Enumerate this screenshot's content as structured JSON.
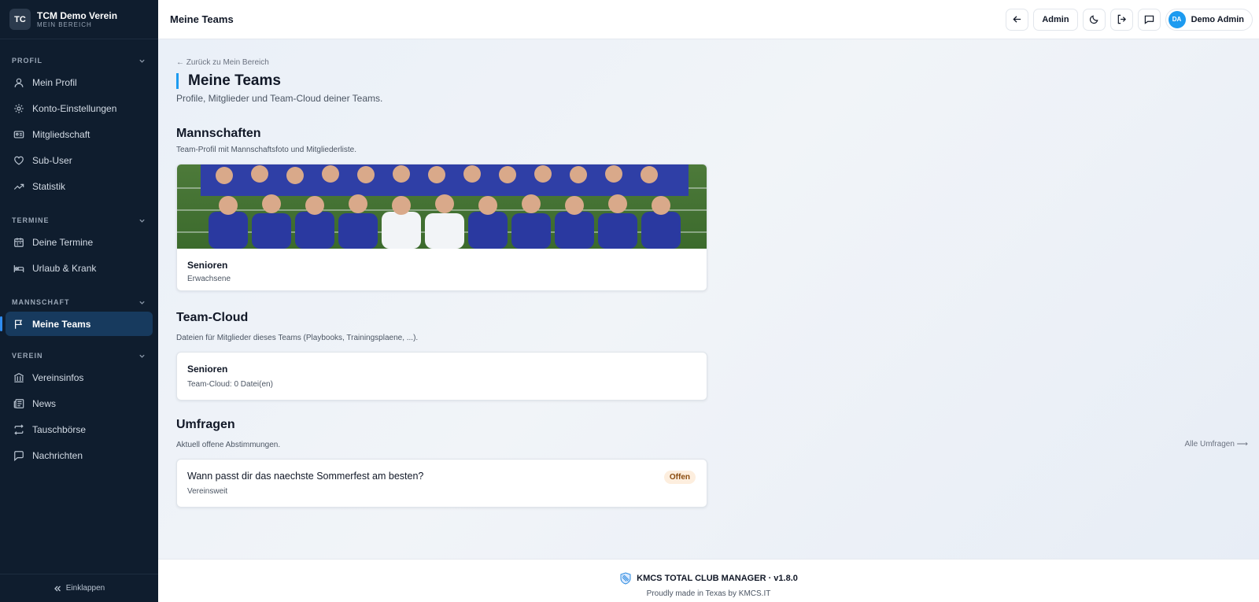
{
  "brand": {
    "badge": "TC",
    "title": "TCM Demo Verein",
    "subtitle": "MEIN BEREICH"
  },
  "sidebar": {
    "sections": [
      {
        "title": "PROFIL",
        "items": [
          {
            "label": "Mein Profil",
            "icon": "user-icon"
          },
          {
            "label": "Konto-Einstellungen",
            "icon": "gear-icon"
          },
          {
            "label": "Mitgliedschaft",
            "icon": "id-card-icon"
          },
          {
            "label": "Sub-User",
            "icon": "heart-icon"
          },
          {
            "label": "Statistik",
            "icon": "trend-icon"
          }
        ]
      },
      {
        "title": "TERMINE",
        "items": [
          {
            "label": "Deine Termine",
            "icon": "calendar-icon"
          },
          {
            "label": "Urlaub & Krank",
            "icon": "bed-icon"
          }
        ]
      },
      {
        "title": "MANNSCHAFT",
        "items": [
          {
            "label": "Meine Teams",
            "icon": "flag-icon",
            "active": true
          }
        ]
      },
      {
        "title": "VEREIN",
        "items": [
          {
            "label": "Vereinsinfos",
            "icon": "building-icon"
          },
          {
            "label": "News",
            "icon": "newspaper-icon"
          },
          {
            "label": "Tauschbörse",
            "icon": "swap-icon"
          },
          {
            "label": "Nachrichten",
            "icon": "message-icon"
          }
        ]
      }
    ],
    "collapse_label": "Einklappen"
  },
  "header": {
    "title": "Meine Teams",
    "admin_label": "Admin",
    "user": {
      "initials": "DA",
      "name": "Demo Admin"
    }
  },
  "main": {
    "back_link": "← Zurück zu Mein Bereich",
    "title": "Meine Teams",
    "subtitle": "Profile, Mitglieder und Team-Cloud deiner Teams.",
    "teams": {
      "title": "Mannschaften",
      "subtitle": "Team-Profil mit Mannschaftsfoto und Mitgliederliste.",
      "card": {
        "name": "Senioren",
        "category": "Erwachsene"
      }
    },
    "cloud": {
      "title": "Team-Cloud",
      "subtitle": "Dateien für Mitglieder dieses Teams (Playbooks, Trainingsplaene, ...).",
      "card": {
        "name": "Senioren",
        "info": "Team-Cloud: 0 Datei(en)"
      }
    },
    "polls": {
      "title": "Umfragen",
      "subtitle": "Aktuell offene Abstimmungen.",
      "all_link": "Alle Umfragen ⟶",
      "card": {
        "question": "Wann passt dir das naechste Sommerfest am besten?",
        "scope": "Vereinsweit",
        "status": "Offen"
      }
    }
  },
  "footer": {
    "line1": "KMCS TOTAL CLUB MANAGER · v1.8.0",
    "line2": "Proudly made in Texas by KMCS.IT"
  },
  "colors": {
    "sidebar": "#0f1d2e",
    "active": "#173a5e",
    "accent": "#1d9bf0",
    "badge_bg": "#fdeede"
  }
}
